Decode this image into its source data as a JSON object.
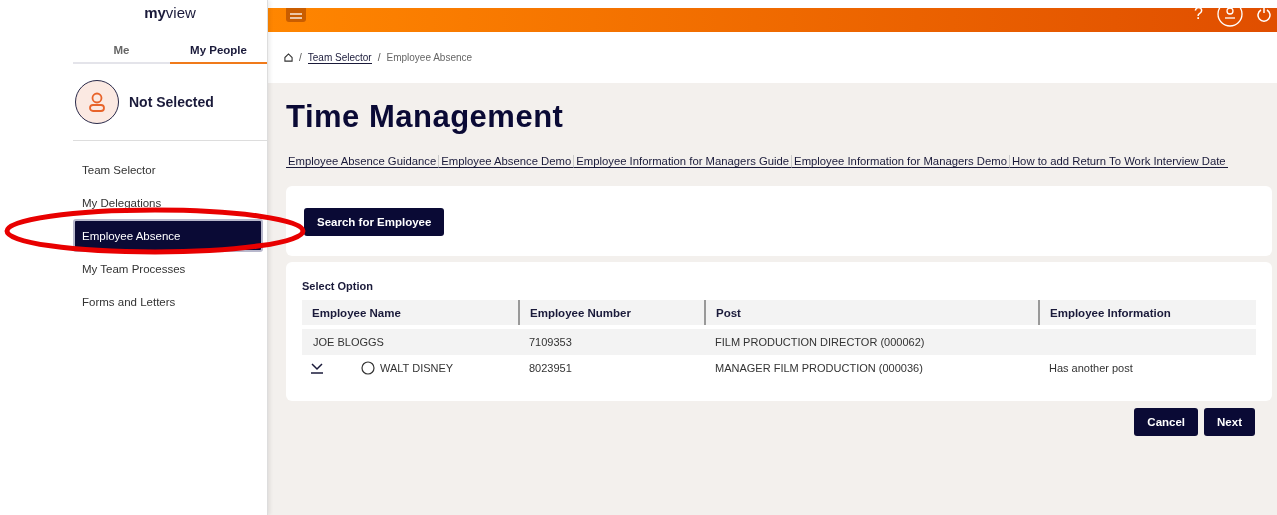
{
  "sidebar": {
    "logo": {
      "bold": "my",
      "light": "view"
    },
    "tabs": [
      {
        "label": "Me",
        "selected": false
      },
      {
        "label": "My People",
        "selected": true
      }
    ],
    "profile": {
      "name": "Not Selected"
    },
    "items": [
      {
        "label": "Team Selector",
        "selected": false
      },
      {
        "label": "My Delegations",
        "selected": false
      },
      {
        "label": "Employee Absence",
        "selected": true
      },
      {
        "label": "My Team Processes",
        "selected": false
      },
      {
        "label": "Forms and Letters",
        "selected": false
      }
    ]
  },
  "header": {
    "help": "?"
  },
  "breadcrumb": [
    {
      "separator": "/",
      "label": "Team Selector",
      "link": true
    },
    {
      "separator": "/",
      "label": "Employee Absence",
      "link": false
    }
  ],
  "title": "Time Management",
  "links": [
    "Employee Absence Guidance",
    "Employee Absence Demo",
    "Employee Information for Managers Guide",
    "Employee Information for Managers Demo",
    "How to add Return To Work Interview Date"
  ],
  "search_button": "Search for Employee",
  "table": {
    "caption": "Select Option",
    "columns": [
      "Employee Name",
      "Employee Number",
      "Post",
      "Employee Information"
    ],
    "rows": [
      {
        "kind": "plain",
        "cells": [
          "JOE BLOGGS",
          "7109353",
          "FILM PRODUCTION DIRECTOR (000062)"
        ]
      },
      {
        "kind": "expandable",
        "radio": {
          "selected": false
        },
        "cells": [
          "WALT DISNEY",
          "8023951",
          "MANAGER FILM PRODUCTION (000036)",
          "Has another post"
        ]
      }
    ]
  },
  "buttons": [
    "Cancel",
    "Next"
  ]
}
